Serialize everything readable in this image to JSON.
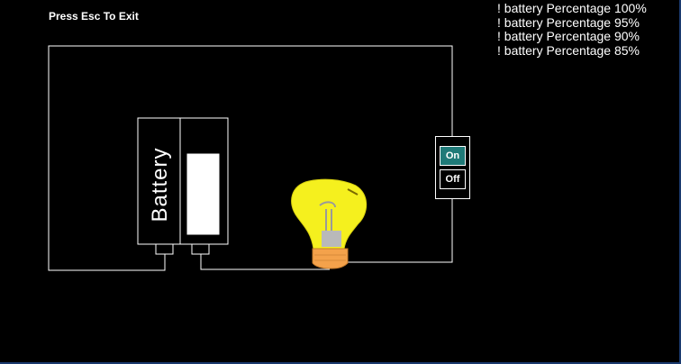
{
  "header": {
    "exit_hint": "Press Esc To Exit"
  },
  "log": {
    "lines": [
      "! battery Percentage 100%",
      "! battery Percentage 95%",
      "! battery Percentage 90%",
      "! battery Percentage 85%"
    ]
  },
  "battery": {
    "label": "Battery",
    "charge_percent": 85
  },
  "switch": {
    "on_label": "On",
    "off_label": "Off",
    "state": "on",
    "on_color": "#1f7a78"
  },
  "bulb": {
    "lit": true,
    "glass_color": "#f5f01e",
    "base_color": "#f4a24b"
  },
  "colors": {
    "background": "#000000",
    "wire": "#ffffff",
    "window_border": "#1a3a6e"
  }
}
